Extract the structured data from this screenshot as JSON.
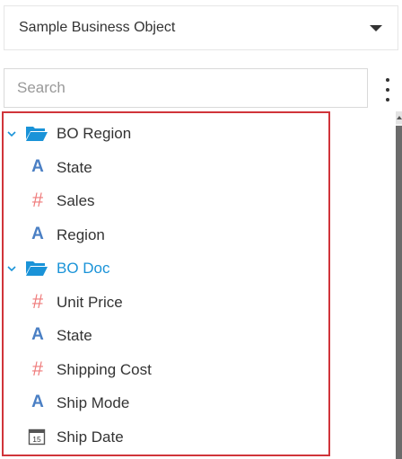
{
  "object_selector": {
    "label": "Sample Business Object",
    "icon": "caret-down-icon"
  },
  "search": {
    "placeholder": "Search",
    "value": ""
  },
  "menu": {
    "icon": "kebab-menu-icon"
  },
  "tree": {
    "groups": [
      {
        "label": "BO Region",
        "expanded": true,
        "label_color": "#333333",
        "fields": [
          {
            "label": "State",
            "type": "text"
          },
          {
            "label": "Sales",
            "type": "number"
          },
          {
            "label": "Region",
            "type": "text"
          }
        ]
      },
      {
        "label": "BO Doc",
        "expanded": true,
        "label_color": "#1a93d8",
        "fields": [
          {
            "label": "Unit Price",
            "type": "number"
          },
          {
            "label": "State",
            "type": "text"
          },
          {
            "label": "Shipping Cost",
            "type": "number"
          },
          {
            "label": "Ship Mode",
            "type": "text"
          },
          {
            "label": "Ship Date",
            "type": "date",
            "icon_text": "15"
          }
        ]
      }
    ]
  },
  "colors": {
    "highlight_border": "#d0343a",
    "folder": "#1a93d8",
    "text_type_icon": "#4a7fc4",
    "number_type_icon": "#ef7b7b"
  }
}
